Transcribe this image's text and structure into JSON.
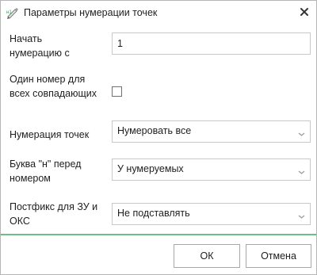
{
  "window": {
    "title": "Параметры нумерации точек",
    "app_icon": "pencil-measure-icon",
    "close_icon": "close-icon"
  },
  "form": {
    "start_number": {
      "label": "Начать нумерацию с",
      "value": "1"
    },
    "same_number": {
      "label": "Один номер для всех совпадающих",
      "checked": false
    },
    "numbering": {
      "label": "Нумерация точек",
      "value": "Нумеровать все"
    },
    "letter_n": {
      "label": "Буква \"н\" перед номером",
      "value": "У нумеруемых"
    },
    "postfix": {
      "label": "Постфикс для ЗУ и ОКС",
      "value": "Не подставлять"
    }
  },
  "buttons": {
    "ok": "ОК",
    "cancel": "Отмена"
  },
  "colors": {
    "separator": "#6cbf8b",
    "icon_green": "#3a9a5b"
  }
}
